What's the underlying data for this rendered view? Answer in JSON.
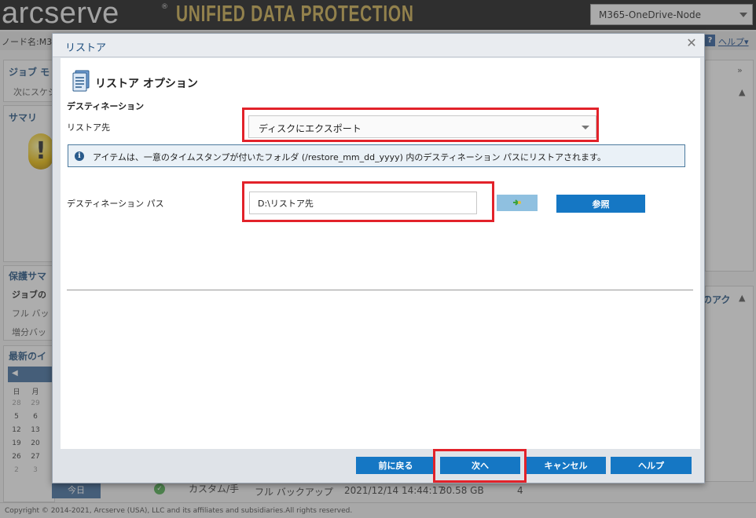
{
  "app": {
    "brand": "arcserve",
    "product": "UNIFIED DATA PROTECTION",
    "node_selector": "M365-OneDrive-Node",
    "node_label": "ノード名:M3",
    "help_link": "ヘルプ▾",
    "copyright": "Copyright © 2014-2021, Arcserve (USA), LLC and its affiliates and subsidiaries.All rights reserved."
  },
  "background": {
    "job_monitor_title": "ジョブ モ",
    "next_schedule_text": "次にスケジ",
    "summary_title": "サマリ",
    "protection_summary_title": "保護サマ",
    "job_row_label": "ジョブの",
    "full_backup_label": "フル バッ",
    "incremental_label": "増分バッ",
    "latest_events_title": "最新のイ",
    "actions_title": "のアク",
    "calendar_headers": [
      "日",
      "月"
    ],
    "calendar_rows": [
      [
        "28",
        "29"
      ],
      [
        "5",
        "6"
      ],
      [
        "12",
        "13"
      ],
      [
        "19",
        "20"
      ],
      [
        "26",
        "27"
      ],
      [
        "2",
        "3"
      ]
    ],
    "today_button": "今日",
    "event_row": {
      "name": "カスタム/手",
      "type": "フル バックアップ",
      "time": "2021/12/14 14:44:17",
      "size": "30.58 GB",
      "extra": "4"
    }
  },
  "dialog": {
    "title": "リストア",
    "options_heading": "リストア オプション",
    "destination_subheading": "デスティネーション",
    "restore_to_label": "リストア先",
    "restore_to_value": "ディスクにエクスポート",
    "info_text": "アイテムは、一意のタイムスタンプが付いたフォルダ (/restore_mm_dd_yyyy) 内のデスティネーション パスにリストアされます。",
    "destination_path_label": "デスティネーション パス",
    "destination_path_value": "D:\\リストア先",
    "browse_label": "参照",
    "back_label": "前に戻る",
    "next_label": "次へ",
    "cancel_label": "キャンセル",
    "help_label": "ヘルプ"
  },
  "icons": {
    "close": "close-icon",
    "info": "info-icon",
    "options": "document-options-icon",
    "arrow": "green-arrow-icon",
    "warning": "warning-icon"
  },
  "colors": {
    "accent_button": "#1577c4",
    "highlight": "#e2222a",
    "title_blue": "#1f4f7f",
    "product_gold": "#c9a94a"
  }
}
